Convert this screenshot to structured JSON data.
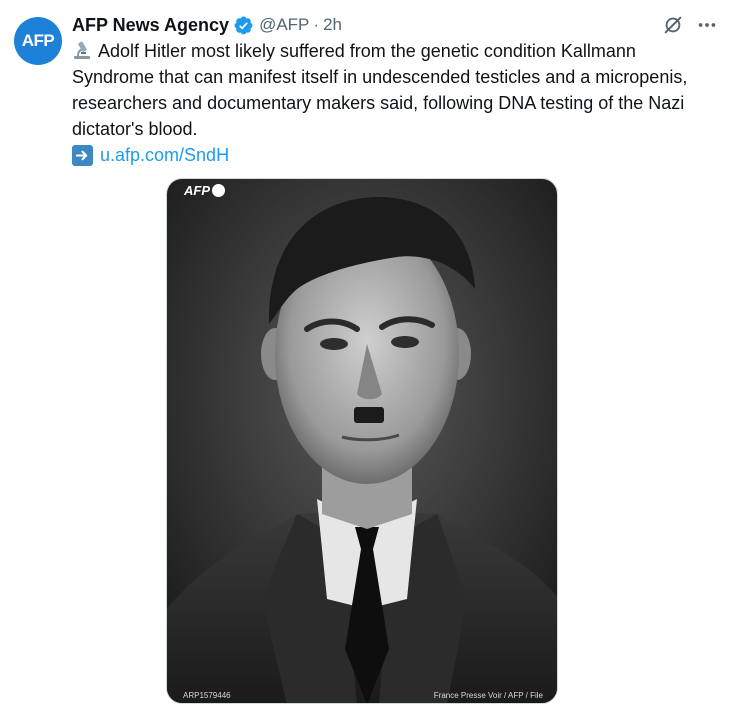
{
  "author": {
    "avatar_text": "AFP",
    "display_name": "AFP News Agency",
    "handle": "@AFP",
    "separator": "·",
    "time": "2h",
    "verified_color": "#1d9bf0"
  },
  "actions": {
    "grok_icon": "grok-icon",
    "more_icon": "more-icon"
  },
  "tweet": {
    "emoji": "microscope-emoji",
    "text": "Adolf Hitler most likely suffered from the genetic condition Kallmann Syndrome that can manifest itself in undescended testicles and a micropenis, researchers and documentary makers said, following DNA testing of the Nazi dictator's blood.",
    "link_emoji": "right-arrow-emoji",
    "link_text": "u.afp.com/SndH"
  },
  "media": {
    "watermark": "AFP",
    "photo_id": "ARP1579446",
    "credit": "France Presse Voir / AFP / File"
  },
  "colors": {
    "avatar_bg": "#1d82d7",
    "link": "#1d9bf0",
    "secondary_text": "#536471"
  }
}
